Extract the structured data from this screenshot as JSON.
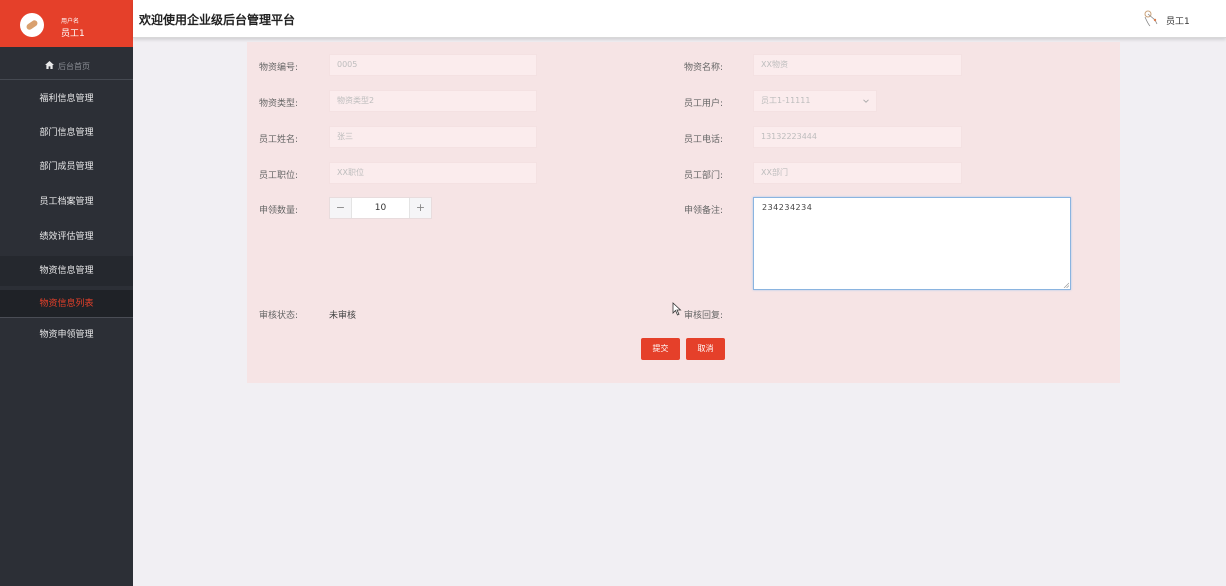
{
  "sidebar": {
    "user_label": "用户名",
    "user_name": "员工1",
    "home_label": "后台首页",
    "items": [
      {
        "label": "福利信息管理"
      },
      {
        "label": "部门信息管理"
      },
      {
        "label": "部门成员管理"
      },
      {
        "label": "员工档案管理"
      },
      {
        "label": "绩效评估管理"
      },
      {
        "label": "物资信息管理"
      },
      {
        "label": "物资申领管理"
      }
    ],
    "submenu_label": "物资信息列表"
  },
  "header": {
    "title": "欢迎使用企业级后台管理平台",
    "user": "员工1"
  },
  "form": {
    "labels": {
      "item_no": "物资编号:",
      "item_name": "物资名称:",
      "item_type": "物资类型:",
      "emp_user": "员工用户:",
      "emp_name": "员工姓名:",
      "emp_phone": "员工电话:",
      "emp_position": "员工职位:",
      "emp_dept": "员工部门:",
      "quantity": "申领数量:",
      "remark": "申领备注:",
      "status": "审核状态:",
      "reply": "审核回复:"
    },
    "values": {
      "item_no": "0005",
      "item_name": "XX物资",
      "item_type": "物资类型2",
      "emp_user": "员工1-11111",
      "emp_name": "张三",
      "emp_phone": "13132223444",
      "emp_position": "XX职位",
      "emp_dept": "XX部门",
      "quantity": "10",
      "remark": "234234234",
      "status": "未审核"
    },
    "stepper": {
      "minus": "−",
      "plus": "+"
    },
    "submit_label": "提交",
    "cancel_label": "取消"
  },
  "colors": {
    "accent": "#e5402a",
    "sidebar_bg": "#2c2f36",
    "panel_bg": "#f6e4e5"
  }
}
